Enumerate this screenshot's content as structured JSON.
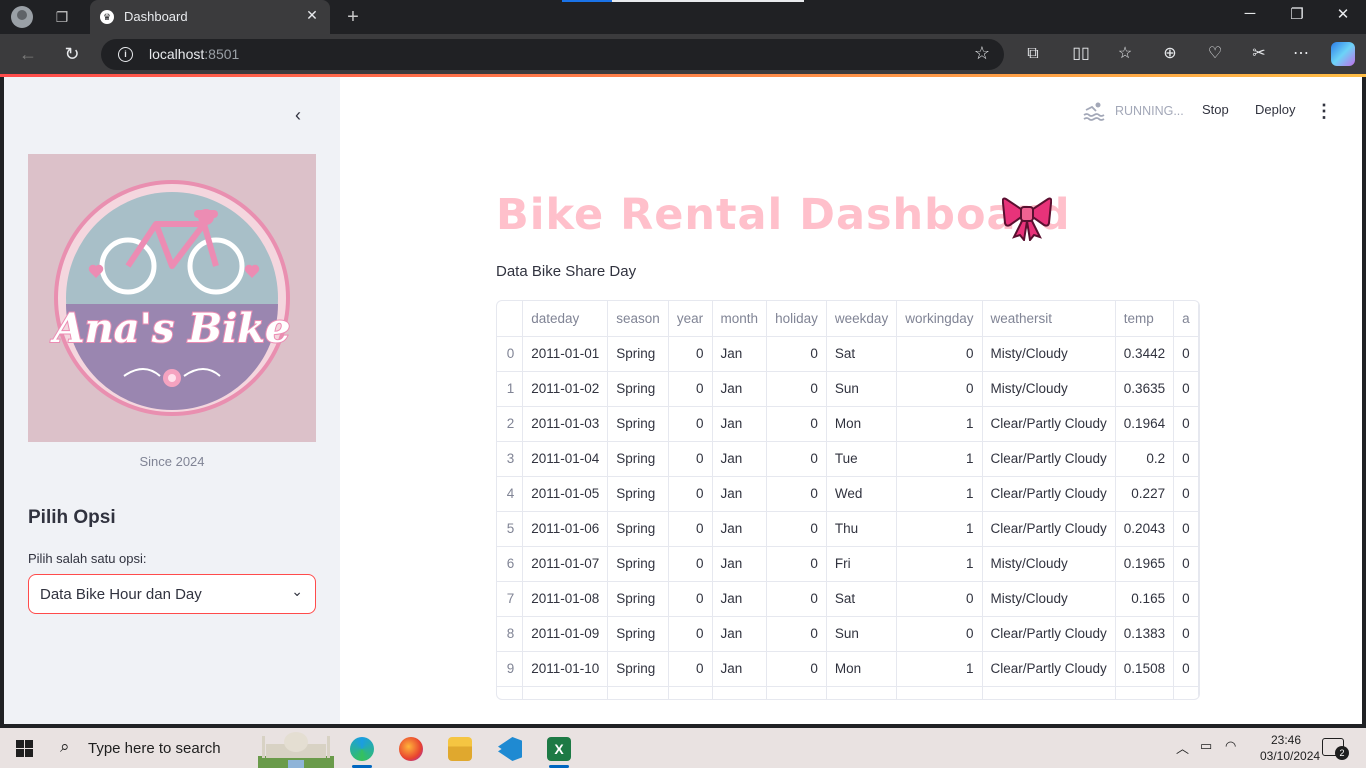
{
  "browser": {
    "tab_title": "Dashboard",
    "url_host": "localhost",
    "url_port": ":8501"
  },
  "header": {
    "running_label": "RUNNING...",
    "stop_label": "Stop",
    "deploy_label": "Deploy"
  },
  "sidebar": {
    "logo_text": "Ana's Bike",
    "caption": "Since 2024",
    "header": "Pilih Opsi",
    "select_label": "Pilih salah satu opsi:",
    "select_value": "Data Bike Hour dan Day"
  },
  "main": {
    "title": "Bike Rental Dashboard",
    "subtitle": "Data Bike Share Day",
    "table": {
      "columns": [
        "dateday",
        "season",
        "year",
        "month",
        "holiday",
        "weekday",
        "workingday",
        "weathersit",
        "temp",
        "a"
      ],
      "rows": [
        [
          "0",
          "2011-01-01",
          "Spring",
          "0",
          "Jan",
          "0",
          "Sat",
          "0",
          "Misty/Cloudy",
          "0.3442",
          "0"
        ],
        [
          "1",
          "2011-01-02",
          "Spring",
          "0",
          "Jan",
          "0",
          "Sun",
          "0",
          "Misty/Cloudy",
          "0.3635",
          "0"
        ],
        [
          "2",
          "2011-01-03",
          "Spring",
          "0",
          "Jan",
          "0",
          "Mon",
          "1",
          "Clear/Partly Cloudy",
          "0.1964",
          "0"
        ],
        [
          "3",
          "2011-01-04",
          "Spring",
          "0",
          "Jan",
          "0",
          "Tue",
          "1",
          "Clear/Partly Cloudy",
          "0.2",
          "0"
        ],
        [
          "4",
          "2011-01-05",
          "Spring",
          "0",
          "Jan",
          "0",
          "Wed",
          "1",
          "Clear/Partly Cloudy",
          "0.227",
          "0"
        ],
        [
          "5",
          "2011-01-06",
          "Spring",
          "0",
          "Jan",
          "0",
          "Thu",
          "1",
          "Clear/Partly Cloudy",
          "0.2043",
          "0"
        ],
        [
          "6",
          "2011-01-07",
          "Spring",
          "0",
          "Jan",
          "0",
          "Fri",
          "1",
          "Misty/Cloudy",
          "0.1965",
          "0"
        ],
        [
          "7",
          "2011-01-08",
          "Spring",
          "0",
          "Jan",
          "0",
          "Sat",
          "0",
          "Misty/Cloudy",
          "0.165",
          "0"
        ],
        [
          "8",
          "2011-01-09",
          "Spring",
          "0",
          "Jan",
          "0",
          "Sun",
          "0",
          "Clear/Partly Cloudy",
          "0.1383",
          "0"
        ],
        [
          "9",
          "2011-01-10",
          "Spring",
          "0",
          "Jan",
          "0",
          "Mon",
          "1",
          "Clear/Partly Cloudy",
          "0.1508",
          "0"
        ],
        [
          "",
          "",
          "",
          "",
          "",
          "",
          "",
          "",
          "",
          "",
          ""
        ]
      ]
    }
  },
  "taskbar": {
    "search_placeholder": "Type here to search",
    "time": "23:46",
    "date": "03/10/2024",
    "notification_count": "2"
  },
  "colors": {
    "title_pink": "#ffc0cb",
    "accent_red": "#ff4b4b",
    "sidebar_bg": "#f0f2f6",
    "text": "#31333f"
  },
  "icons": [
    "profile-icon",
    "workspaces-icon",
    "streamlit-favicon",
    "close-icon",
    "plus-icon",
    "minimize-icon",
    "maximize-icon",
    "back-icon",
    "refresh-icon",
    "info-icon",
    "star-icon",
    "extensions-icon",
    "split-screen-icon",
    "favorites-icon",
    "collections-icon",
    "performance-icon",
    "screenshot-icon",
    "more-icon",
    "copilot-icon",
    "chevron-left-icon",
    "swimmer-icon",
    "kebab-menu-icon",
    "chevron-down-icon",
    "ribbon-bow-icon",
    "windows-start-icon",
    "search-icon",
    "edge-icon",
    "firefox-icon",
    "file-explorer-icon",
    "vscode-icon",
    "excel-icon",
    "chevron-up-icon",
    "battery-icon",
    "wifi-icon",
    "notification-icon"
  ]
}
